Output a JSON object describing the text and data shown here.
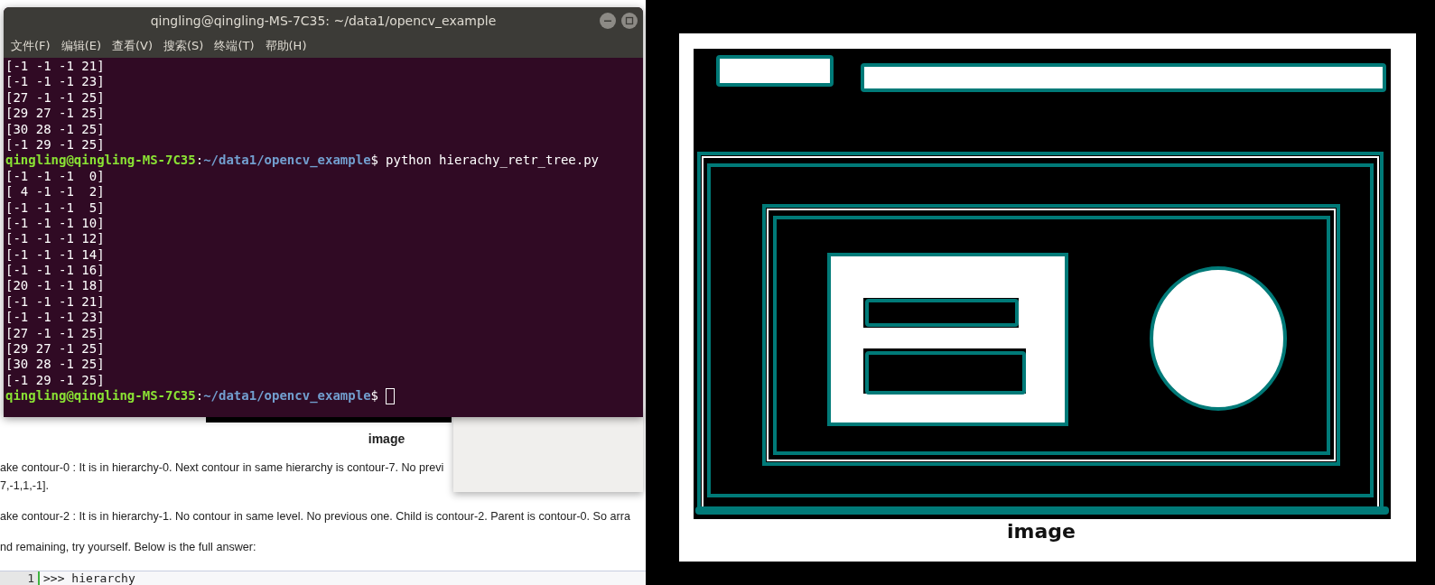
{
  "page": {
    "image_caption": "image",
    "paragraphs": [
      "ake contour-0 : It is in hierarchy-0. Next contour in same hierarchy is contour-7. No previ",
      "7,-1,1,-1].",
      "ake contour-2 : It is in hierarchy-1. No contour in same level. No previous one. Child is contour-2. Parent is contour-0. So arra",
      "nd remaining, try yourself. Below is the full answer:"
    ],
    "code_lines": [
      {
        "number": "1",
        "text": ">>> hierarchy"
      }
    ]
  },
  "terminal": {
    "title": "qingling@qingling-MS-7C35: ~/data1/opencv_example",
    "menu": [
      "文件(F)",
      "编辑(E)",
      "查看(V)",
      "搜索(S)",
      "终端(T)",
      "帮助(H)"
    ],
    "lines": [
      {
        "kind": "output",
        "text": "[-1 -1 -1 21]"
      },
      {
        "kind": "output",
        "text": "[-1 -1 -1 23]"
      },
      {
        "kind": "output",
        "text": "[27 -1 -1 25]"
      },
      {
        "kind": "output",
        "text": "[29 27 -1 25]"
      },
      {
        "kind": "output",
        "text": "[30 28 -1 25]"
      },
      {
        "kind": "output",
        "text": "[-1 29 -1 25]"
      },
      {
        "kind": "prompt",
        "user": "qingling@qingling-MS-7C35",
        "sep": ":",
        "path": "~/data1/opencv_example",
        "dollar": "$",
        "command": "python hierachy_retr_tree.py"
      },
      {
        "kind": "output",
        "text": "[-1 -1 -1  0]"
      },
      {
        "kind": "output",
        "text": "[ 4 -1 -1  2]"
      },
      {
        "kind": "output",
        "text": "[-1 -1 -1  5]"
      },
      {
        "kind": "output",
        "text": "[-1 -1 -1 10]"
      },
      {
        "kind": "output",
        "text": "[-1 -1 -1 12]"
      },
      {
        "kind": "output",
        "text": "[-1 -1 -1 14]"
      },
      {
        "kind": "output",
        "text": "[-1 -1 -1 16]"
      },
      {
        "kind": "output",
        "text": "[20 -1 -1 18]"
      },
      {
        "kind": "output",
        "text": "[-1 -1 -1 21]"
      },
      {
        "kind": "output",
        "text": "[-1 -1 -1 23]"
      },
      {
        "kind": "output",
        "text": "[27 -1 -1 25]"
      },
      {
        "kind": "output",
        "text": "[29 27 -1 25]"
      },
      {
        "kind": "output",
        "text": "[30 28 -1 25]"
      },
      {
        "kind": "output",
        "text": "[-1 29 -1 25]"
      },
      {
        "kind": "prompt",
        "user": "qingling@qingling-MS-7C35",
        "sep": ":",
        "path": "~/data1/opencv_example",
        "dollar": "$",
        "cursor": true
      }
    ]
  },
  "image_window": {
    "caption": "image"
  }
}
